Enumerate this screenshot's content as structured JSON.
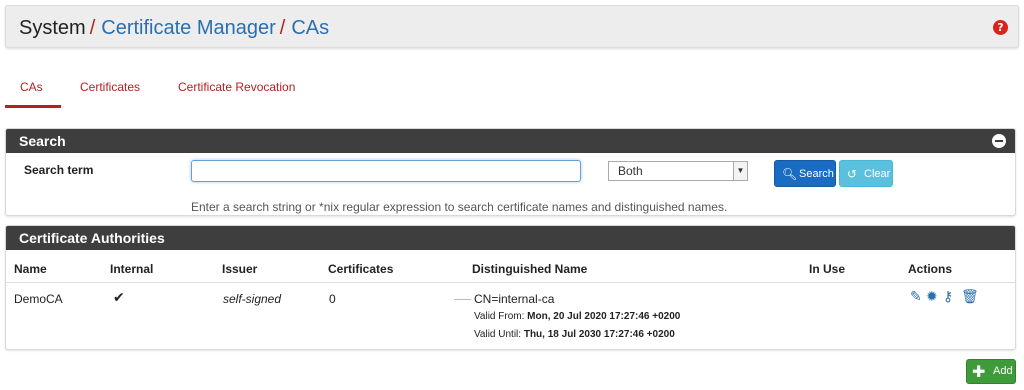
{
  "breadcrumb": {
    "root": "System",
    "separator": "/",
    "level2": "Certificate Manager",
    "level3": "CAs",
    "help_icon": "question-circle-icon"
  },
  "tabs": [
    {
      "label": "CAs",
      "active": true
    },
    {
      "label": "Certificates",
      "active": false
    },
    {
      "label": "Certificate Revocation",
      "active": false
    }
  ],
  "search": {
    "title": "Search",
    "term_label": "Search term",
    "input_value": "",
    "select_value": "Both",
    "search_button": "Search",
    "clear_button": "Clear",
    "help_text": "Enter a search string or *nix regular expression to search certificate names and distinguished names."
  },
  "ca_table": {
    "title": "Certificate Authorities",
    "columns": [
      "Name",
      "Internal",
      "Issuer",
      "Certificates",
      "Distinguished Name",
      "In Use",
      "Actions"
    ],
    "rows": [
      {
        "name": "DemoCA",
        "internal": "✔",
        "issuer": "self-signed",
        "certificates": "0",
        "dn": "CN=internal-ca",
        "valid_from_label": "Valid From:",
        "valid_from": "Mon, 20 Jul 2020 17:27:46 +0200",
        "valid_until_label": "Valid Until:",
        "valid_until": "Thu, 18 Jul 2030 17:27:46 +0200",
        "in_use": "",
        "actions": [
          "pencil-icon",
          "certificate-icon",
          "key-icon",
          "trash-icon"
        ]
      }
    ]
  },
  "add_button": "Add",
  "colors": {
    "accent_red": "#b22222",
    "link_blue": "#2a6fb0",
    "panel_header": "#3e3e3e",
    "search_button": "#1a6bc2",
    "clear_button": "#5bc0de",
    "add_button": "#3f9b3a"
  }
}
